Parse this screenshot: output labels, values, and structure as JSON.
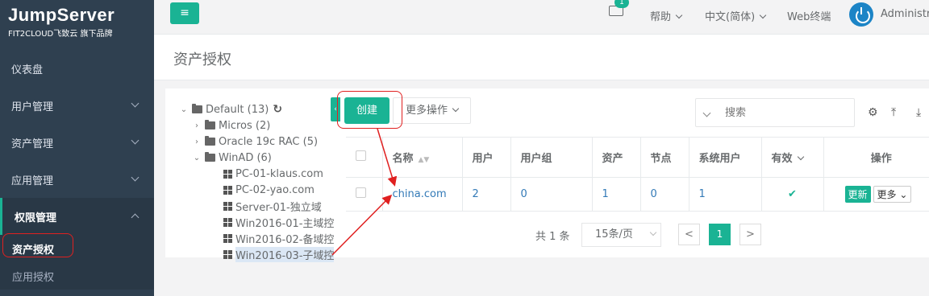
{
  "brand": {
    "title": "JumpServer",
    "subtitle": "FIT2CLOUD飞致云 旗下品牌"
  },
  "sidebar": {
    "items": [
      {
        "label": "仪表盘"
      },
      {
        "label": "用户管理"
      },
      {
        "label": "资产管理"
      },
      {
        "label": "应用管理"
      },
      {
        "label": "权限管理"
      }
    ],
    "subitems": [
      {
        "label": "资产授权"
      },
      {
        "label": "应用授权"
      }
    ]
  },
  "topbar": {
    "menu_icon": "≡",
    "mail_count": "1",
    "help": "帮助",
    "language": "中文(简体)",
    "web_terminal": "Web终端",
    "user": "Administrator"
  },
  "page": {
    "title": "资产授权"
  },
  "tree": {
    "root": "Default (13)",
    "refresh_icon": "↻",
    "nodes": [
      {
        "label": "Micros (2)"
      },
      {
        "label": "Oracle 19c RAC (5)"
      },
      {
        "label": "WinAD (6)"
      }
    ],
    "assets": [
      {
        "label": "PC-01-klaus.com"
      },
      {
        "label": "PC-02-yao.com"
      },
      {
        "label": "Server-01-独立域"
      },
      {
        "label": "Win2016-01-主域控"
      },
      {
        "label": "Win2016-02-备域控"
      },
      {
        "label": "Win2016-03-子域控"
      }
    ]
  },
  "toolbar": {
    "create": "创建",
    "more_ops": "更多操作",
    "search_placeholder": "搜索"
  },
  "table": {
    "columns": [
      "名称",
      "用户",
      "用户组",
      "资产",
      "节点",
      "系统用户",
      "有效",
      "操作"
    ],
    "rows": [
      {
        "name": "china.com",
        "users": "2",
        "groups": "0",
        "assets": "1",
        "nodes": "0",
        "system_users": "1",
        "valid": "✔",
        "update": "更新",
        "more": "更多"
      }
    ]
  },
  "pagination": {
    "total": "共 1 条",
    "page_size": "15条/页",
    "prev": "<",
    "current": "1",
    "next": ">"
  },
  "colors": {
    "accent": "#1ab394",
    "sidebar": "#2f4050",
    "annotation": "#e02020"
  }
}
